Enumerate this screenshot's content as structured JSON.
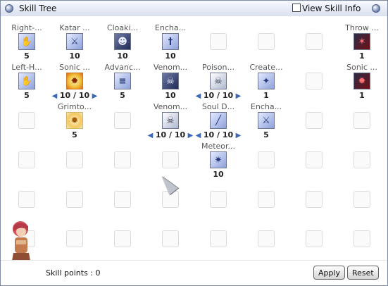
{
  "window": {
    "title": "Skill Tree",
    "view_skill_info_label": "View Skill Info",
    "view_skill_info_checked": false
  },
  "skills": [
    {
      "name": "Right-...",
      "level": "5",
      "icon": "right-hand-mastery-icon",
      "style": "ic-blue",
      "glyph": "✋",
      "col": 0,
      "row": 0,
      "arrows": false
    },
    {
      "name": "Katar ...",
      "level": "10",
      "icon": "katar-mastery-icon",
      "style": "ic-blue",
      "glyph": "⚔",
      "col": 1,
      "row": 0,
      "arrows": false
    },
    {
      "name": "Cloaki...",
      "level": "10",
      "icon": "cloaking-icon",
      "style": "ic-dark",
      "glyph": "☻",
      "col": 2,
      "row": 0,
      "arrows": false
    },
    {
      "name": "Encha...",
      "level": "10",
      "icon": "enchant-poison-icon",
      "style": "ic-blue",
      "glyph": "†",
      "col": 3,
      "row": 0,
      "arrows": false
    },
    {
      "name": "Throw ...",
      "level": "1",
      "icon": "throw-venom-knife-icon",
      "style": "ic-red",
      "glyph": "✶",
      "col": 7,
      "row": 0,
      "arrows": false
    },
    {
      "name": "Left-H...",
      "level": "5",
      "icon": "left-hand-mastery-icon",
      "style": "ic-blue",
      "glyph": "✋",
      "col": 0,
      "row": 1,
      "arrows": false
    },
    {
      "name": "Sonic ...",
      "level": "10 / 10",
      "icon": "sonic-blow-icon",
      "style": "ic-sonic",
      "glyph": "✹",
      "col": 1,
      "row": 1,
      "arrows": true
    },
    {
      "name": "Advanc...",
      "level": "5",
      "icon": "advanced-katar-mastery-icon",
      "style": "ic-blue",
      "glyph": "≡",
      "col": 2,
      "row": 1,
      "arrows": false
    },
    {
      "name": "Venom...",
      "level": "10",
      "icon": "venom-dust-icon",
      "style": "ic-dark",
      "glyph": "☠",
      "col": 3,
      "row": 1,
      "arrows": false
    },
    {
      "name": "Poison...",
      "level": "10 / 10",
      "icon": "poison-react-icon",
      "style": "ic-white",
      "glyph": "☠",
      "col": 4,
      "row": 1,
      "arrows": true
    },
    {
      "name": "Create...",
      "level": "1",
      "icon": "create-deadly-poison-icon",
      "style": "ic-blue",
      "glyph": "✦",
      "col": 5,
      "row": 1,
      "arrows": false
    },
    {
      "name": "Sonic ...",
      "level": "1",
      "icon": "sonic-acceleration-icon",
      "style": "ic-red",
      "glyph": "✹",
      "col": 7,
      "row": 1,
      "arrows": false
    },
    {
      "name": "Grimto...",
      "level": "5",
      "icon": "grimtooth-icon",
      "style": "ic-grimtooth",
      "glyph": "✹",
      "col": 1,
      "row": 2,
      "arrows": false
    },
    {
      "name": "Venom...",
      "level": "10 / 10",
      "icon": "venom-splasher-icon",
      "style": "ic-white",
      "glyph": "☠",
      "col": 3,
      "row": 2,
      "arrows": true
    },
    {
      "name": "Soul D...",
      "level": "10 / 10",
      "icon": "soul-destroyer-icon",
      "style": "ic-blue",
      "glyph": "╱",
      "col": 4,
      "row": 2,
      "arrows": true
    },
    {
      "name": "Encha...",
      "level": "5",
      "icon": "enchant-deadly-poison-icon",
      "style": "ic-blue",
      "glyph": "⚔",
      "col": 5,
      "row": 2,
      "arrows": false
    },
    {
      "name": "Meteor...",
      "level": "10",
      "icon": "meteor-assault-icon",
      "style": "ic-blue",
      "glyph": "✷",
      "col": 4,
      "row": 3,
      "arrows": false
    }
  ],
  "empty_slots": [
    [
      4,
      0
    ],
    [
      5,
      0
    ],
    [
      6,
      0
    ],
    [
      6,
      1
    ],
    [
      0,
      2
    ],
    [
      2,
      2
    ],
    [
      6,
      2
    ],
    [
      7,
      2
    ],
    [
      0,
      3
    ],
    [
      1,
      3
    ],
    [
      2,
      3
    ],
    [
      3,
      3
    ],
    [
      5,
      3
    ],
    [
      6,
      3
    ],
    [
      7,
      3
    ],
    [
      0,
      4
    ],
    [
      1,
      4
    ],
    [
      2,
      4
    ],
    [
      3,
      4
    ],
    [
      4,
      4
    ],
    [
      5,
      4
    ],
    [
      6,
      4
    ],
    [
      7,
      4
    ],
    [
      0,
      5
    ],
    [
      1,
      5
    ],
    [
      2,
      5
    ],
    [
      3,
      5
    ],
    [
      4,
      5
    ],
    [
      5,
      5
    ],
    [
      6,
      5
    ],
    [
      7,
      5
    ]
  ],
  "footer": {
    "skill_points_label": "Skill points : 0",
    "apply_label": "Apply",
    "reset_label": "Reset"
  }
}
